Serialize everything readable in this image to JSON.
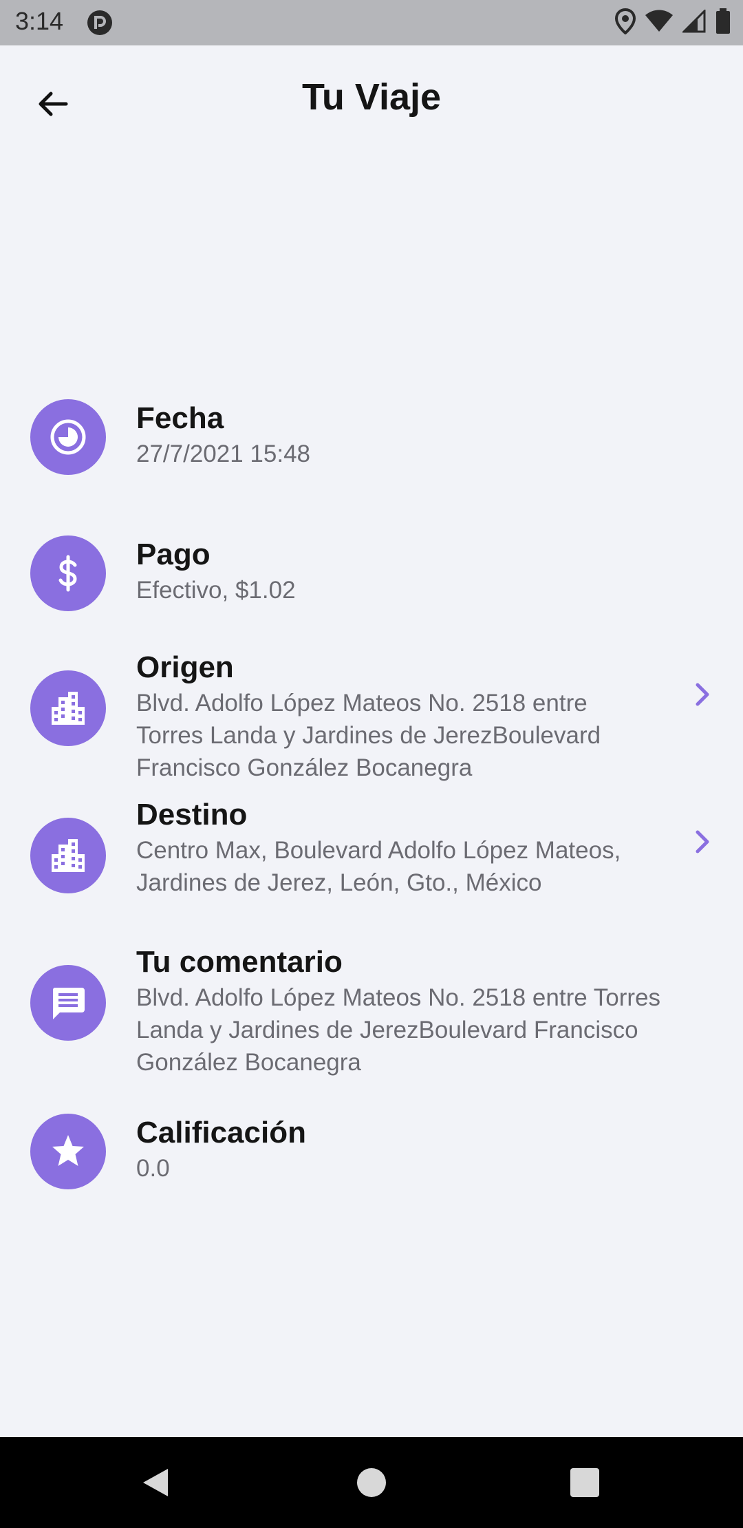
{
  "status_bar": {
    "time": "3:14"
  },
  "header": {
    "title": "Tu Viaje"
  },
  "details": {
    "fecha": {
      "label": "Fecha",
      "value": "27/7/2021 15:48"
    },
    "pago": {
      "label": "Pago",
      "value": "Efectivo, $1.02"
    },
    "origen": {
      "label": "Origen",
      "value": "Blvd. Adolfo López Mateos No. 2518 entre Torres Landa y Jardines de JerezBoulevard Francisco González Bocanegra"
    },
    "destino": {
      "label": "Destino",
      "value": "Centro Max, Boulevard Adolfo López Mateos, Jardines de Jerez, León, Gto., México"
    },
    "comentario": {
      "label": "Tu comentario",
      "value": "Blvd. Adolfo López Mateos No. 2518 entre Torres Landa y Jardines de JerezBoulevard Francisco González Bocanegra"
    },
    "calificacion": {
      "label": "Calificación",
      "value": "0.0"
    }
  },
  "colors": {
    "accent": "#8a6fe0",
    "background": "#f2f3f8",
    "status_bar": "#b5b6ba"
  },
  "icons": {
    "fecha": "clock-icon",
    "pago": "dollar-icon",
    "origen": "building-icon",
    "destino": "building-icon",
    "comentario": "chat-icon",
    "calificacion": "star-icon"
  }
}
